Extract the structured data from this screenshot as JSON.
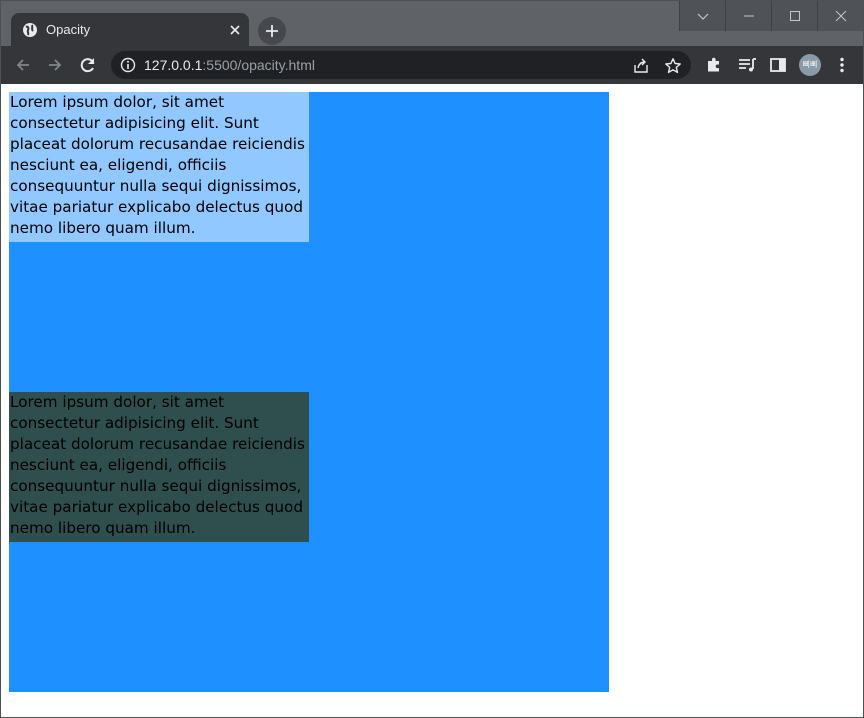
{
  "browser": {
    "tab_title": "Opacity",
    "url_host": "127.0.0.1",
    "url_rest": ":5500/opacity.html",
    "profile_initials": "삐삐",
    "icons": {
      "favicon": "globe-icon",
      "tab_close": "close-icon",
      "new_tab": "plus-icon",
      "back": "back-arrow-icon",
      "forward": "forward-arrow-icon",
      "reload": "reload-icon",
      "site_info": "info-icon",
      "share": "share-icon",
      "bookmark": "star-icon",
      "extensions": "puzzle-icon",
      "media": "media-queue-icon",
      "side_panel": "side-panel-icon",
      "menu": "kebab-menu-icon"
    }
  },
  "page": {
    "outer_box_color": "#1e90ff",
    "boxes": [
      {
        "text": "Lorem ipsum dolor, sit amet consectetur adipisicing elit. Sunt placeat dolorum recusandae reiciendis nesciunt ea, eligendi, officiis consequuntur nulla sequi dignissimos, vitae pariatur explicabo delectus quod nemo libero quam illum.",
        "background_color": "#90c8ff"
      },
      {
        "text": "Lorem ipsum dolor, sit amet consectetur adipisicing elit. Sunt placeat dolorum recusandae reiciendis nesciunt ea, eligendi, officiis consequuntur nulla sequi dignissimos, vitae pariatur explicabo delectus quod nemo libero quam illum.",
        "background_color": "#2f4f4f"
      }
    ]
  }
}
